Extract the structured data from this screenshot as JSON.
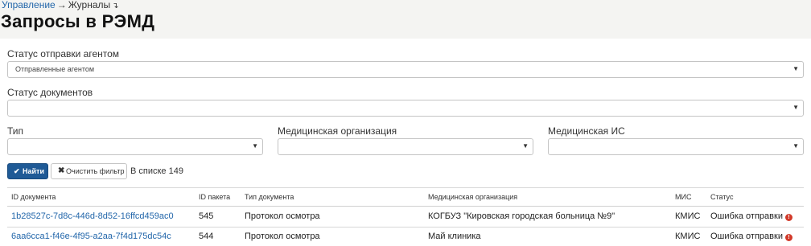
{
  "breadcrumb": {
    "parent": "Управление",
    "separator": "→",
    "current": "Журналы",
    "caret": "↴"
  },
  "page_title": "Запросы в РЭМД",
  "filters": {
    "agent_status": {
      "label": "Статус отправки агентом",
      "value": "Отправленные агентом"
    },
    "doc_status": {
      "label": "Статус документов",
      "value": ""
    },
    "type": {
      "label": "Тип",
      "value": ""
    },
    "med_org": {
      "label": "Медицинская организация",
      "value": ""
    },
    "med_is": {
      "label": "Медицинская ИС",
      "value": ""
    }
  },
  "actions": {
    "find_label": "Найти",
    "clear_label": "Очистить фильтр",
    "count_text": "В списке 149"
  },
  "table": {
    "headers": [
      "ID документа",
      "ID пакета",
      "Тип документа",
      "Медицинская организация",
      "МИС",
      "Статус"
    ],
    "rows": [
      {
        "doc_id": "1b28527c-7d8c-446d-8d52-16ffcd459ac0",
        "package_id": "545",
        "doc_type": "Протокол осмотра",
        "org": "КОГБУЗ \"Кировская городская больница №9\"",
        "mis": "КМИС",
        "status": "Ошибка отправки"
      },
      {
        "doc_id": "6aa6cca1-f46e-4f95-a2aa-7f4d175dc54c",
        "package_id": "544",
        "doc_type": "Протокол осмотра",
        "org": "Май клиника",
        "mis": "КМИС",
        "status": "Ошибка отправки"
      }
    ]
  },
  "colors": {
    "accent": "#1f5a96",
    "link": "#2266aa",
    "error": "#d23a2a",
    "header_bg": "#f4f4f2"
  },
  "icons": {
    "find": "check-icon",
    "clear": "x-icon",
    "status_error": "exclamation-circle-icon",
    "dropdown": "caret-down-icon"
  }
}
